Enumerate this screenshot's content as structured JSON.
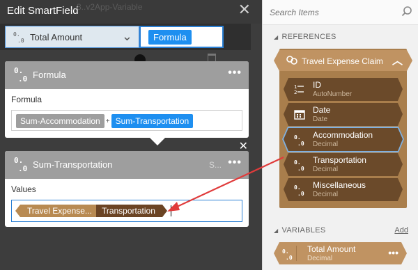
{
  "window": {
    "title": "Edit SmartField",
    "ghost_text": "...8..v2App-Variable"
  },
  "editor": {
    "type_select": {
      "icon": "decimal-icon",
      "label": "Total Amount"
    },
    "mode_chip": "Formula",
    "formula_card": {
      "title": "Formula",
      "field_label": "Formula",
      "tokens": {
        "first": "Sum-Accommodation",
        "operator": "+",
        "second": "Sum-Transportation"
      }
    },
    "values_card": {
      "title": "Sum-Transportation",
      "hint": "S...",
      "field_label": "Values",
      "token": {
        "entity": "Travel Expense...",
        "field": "Transportation"
      }
    }
  },
  "panel": {
    "search_placeholder": "Search Items",
    "references_heading": "REFERENCES",
    "entity": {
      "name": "Travel Expense Claim",
      "icon": "entity-icon"
    },
    "fields": [
      {
        "name": "ID",
        "type": "AutoNumber",
        "icon": "autonumber-icon"
      },
      {
        "name": "Date",
        "type": "Date",
        "icon": "calendar-icon"
      },
      {
        "name": "Accommodation",
        "type": "Decimal",
        "icon": "decimal-icon",
        "selected": true
      },
      {
        "name": "Transportation",
        "type": "Decimal",
        "icon": "decimal-icon"
      },
      {
        "name": "Miscellaneous",
        "type": "Decimal",
        "icon": "decimal-icon"
      }
    ],
    "variables_heading": "VARIABLES",
    "add_label": "Add",
    "variable": {
      "name": "Total Amount",
      "type": "Decimal",
      "icon": "decimal-icon"
    }
  },
  "colors": {
    "accent_blue": "#1e8ff0",
    "entity_tan": "#c09362",
    "field_brown": "#6b4a2a",
    "arrow_red": "#e03b3b"
  }
}
